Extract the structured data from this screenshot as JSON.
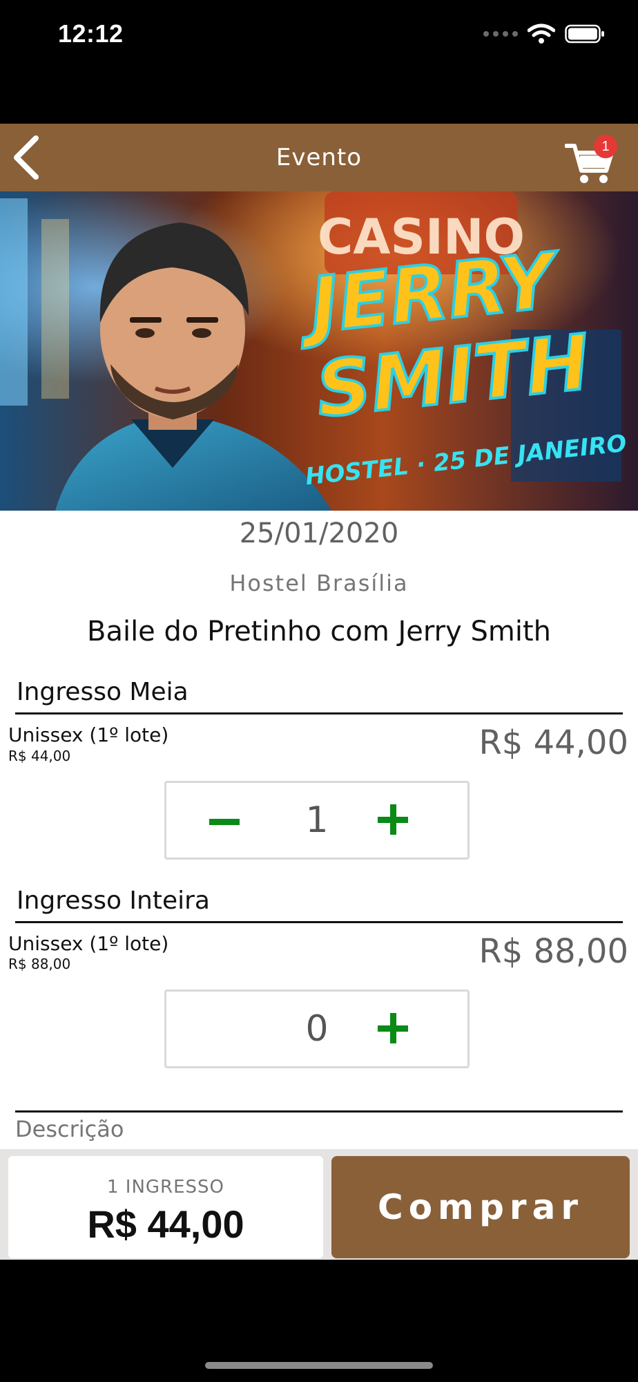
{
  "status_bar": {
    "time": "12:12"
  },
  "header": {
    "title": "Evento",
    "cart_count": "1"
  },
  "banner": {
    "headline_line1": "JERRY",
    "headline_line2": "SMITH",
    "tagline": "HOSTEL · 25 DE JANEIRO",
    "sign_text": "CASINO"
  },
  "event": {
    "date": "25/01/2020",
    "venue": "Hostel Brasília",
    "title": "Baile do Pretinho com Jerry Smith"
  },
  "tickets": [
    {
      "section": "Ingresso Meia",
      "name": "Unissex (1º lote)",
      "unit_price": "R$ 44,00",
      "price": "R$ 44,00",
      "quantity": "1",
      "minus_visible": true
    },
    {
      "section": "Ingresso Inteira",
      "name": "Unissex (1º lote)",
      "unit_price": "R$ 88,00",
      "price": "R$ 88,00",
      "quantity": "0",
      "minus_visible": false
    }
  ],
  "description_label": "Descrição",
  "summary": {
    "count_label": "1 INGRESSO",
    "total": "R$ 44,00"
  },
  "buy_button_label": "Comprar",
  "colors": {
    "brand_brown": "#8a6039",
    "stepper_green": "#0a8a16",
    "badge_red": "#e53935"
  }
}
